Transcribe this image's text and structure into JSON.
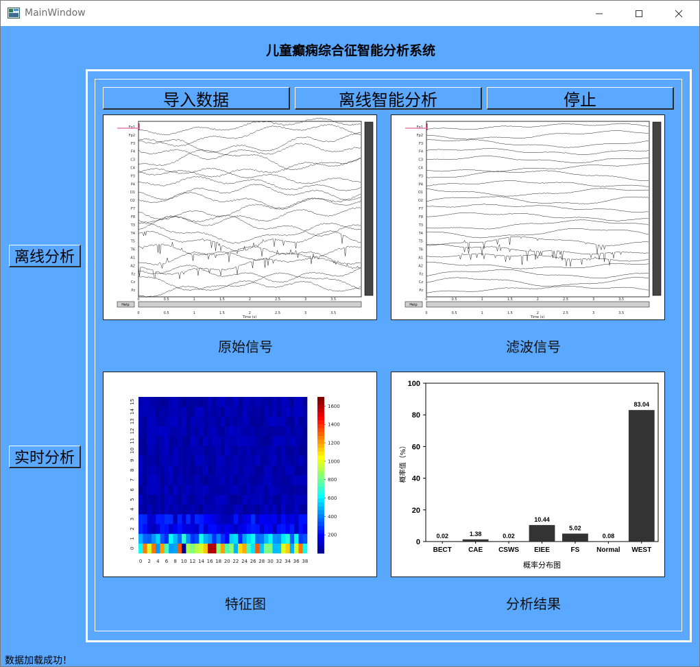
{
  "window": {
    "title": "MainWindow"
  },
  "app": {
    "heading": "儿童癫痫综合征智能分析系统"
  },
  "sidebar": {
    "offline_label": "离线分析",
    "realtime_label": "实时分析"
  },
  "toolbar": {
    "import_label": "导入数据",
    "offline_analysis_label": "离线智能分析",
    "stop_label": "停止"
  },
  "captions": {
    "raw": "原始信号",
    "filtered": "滤波信号",
    "feature": "特征图",
    "result": "分析结果"
  },
  "eeg": {
    "channels": [
      "Fp1",
      "Fp2",
      "F3",
      "F4",
      "C3",
      "C4",
      "P3",
      "P4",
      "O1",
      "O2",
      "F7",
      "F8",
      "T3",
      "T4",
      "T5",
      "T6",
      "A1",
      "A2",
      "Fz",
      "Cz",
      "Pz"
    ],
    "x_ticks": [
      "0",
      "0.5",
      "1",
      "1.5",
      "2",
      "2.5",
      "3",
      "3.5"
    ],
    "xlabel": "Time (s)",
    "help_label": "Help"
  },
  "heatmap": {
    "x_ticks": [
      "0",
      "2",
      "4",
      "6",
      "8",
      "10",
      "12",
      "14",
      "16",
      "18",
      "20",
      "22",
      "24",
      "26",
      "28",
      "30",
      "32",
      "34",
      "36",
      "38"
    ],
    "y_ticks": [
      "0",
      "1",
      "2",
      "3",
      "4",
      "5",
      "6",
      "7",
      "8",
      "9",
      "10",
      "11",
      "12",
      "13",
      "14",
      "15"
    ],
    "colorbar_ticks": [
      "1600",
      "1400",
      "1200",
      "1000",
      "800",
      "600",
      "400",
      "200"
    ],
    "colorbar_range": [
      0,
      1700
    ]
  },
  "chart_data": {
    "type": "bar",
    "categories": [
      "BECT",
      "CAE",
      "CSWS",
      "EIEE",
      "FS",
      "Normal",
      "WEST"
    ],
    "values": [
      0.02,
      1.38,
      0.02,
      10.44,
      5.02,
      0.08,
      83.04
    ],
    "value_labels": [
      "0.02",
      "1.38",
      "0.02",
      "10.44",
      "5.02",
      "0.08",
      "83.04"
    ],
    "xlabel": "概率分布图",
    "ylabel": "概率值（%）",
    "ylim": [
      0,
      100
    ],
    "y_ticks": [
      "0",
      "20",
      "40",
      "60",
      "80",
      "100"
    ],
    "bar_color": "#333333",
    "grid": false
  },
  "status": {
    "message": "数据加载成功！"
  },
  "colors": {
    "background": "#5aa8ff",
    "bar": "#333333"
  }
}
